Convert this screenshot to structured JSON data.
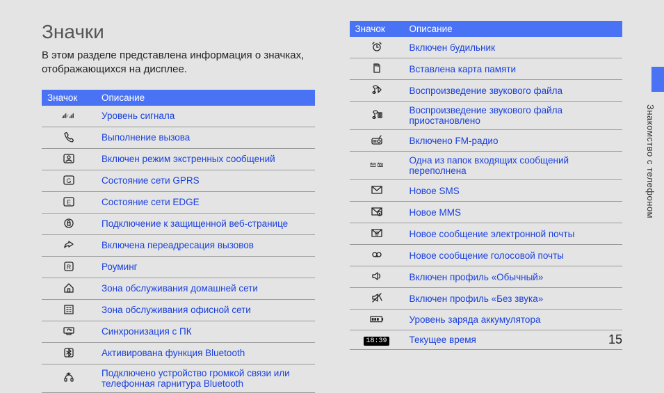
{
  "title": "Значки",
  "intro": "В этом разделе представлена информация о значках, отображающихся на дисплее.",
  "header_icon": "Значок",
  "header_desc": "Описание",
  "side_label": "Знакомство с телефоном",
  "page_number": "15",
  "time_label": "18:39",
  "left_rows": [
    {
      "icon": "signal",
      "desc": "Уровень сигнала"
    },
    {
      "icon": "call",
      "desc": "Выполнение вызова"
    },
    {
      "icon": "sos",
      "desc": "Включен режим экстренных сообщений"
    },
    {
      "icon": "gprs",
      "desc": "Состояние сети GPRS"
    },
    {
      "icon": "edge",
      "desc": "Состояние сети EDGE"
    },
    {
      "icon": "secure",
      "desc": "Подключение к защищенной веб-странице"
    },
    {
      "icon": "forward",
      "desc": "Включена переадресация вызовов"
    },
    {
      "icon": "roaming",
      "desc": "Роуминг"
    },
    {
      "icon": "home",
      "desc": "Зона обслуживания домашней сети"
    },
    {
      "icon": "office",
      "desc": "Зона обслуживания офисной сети"
    },
    {
      "icon": "sync",
      "desc": "Синхронизация с ПК"
    },
    {
      "icon": "bluetooth",
      "desc": "Активирована функция Bluetooth"
    },
    {
      "icon": "headset",
      "desc": "Подключено устройство громкой связи или телефонная гарнитура Bluetooth"
    }
  ],
  "right_rows": [
    {
      "icon": "alarm",
      "desc": "Включен будильник"
    },
    {
      "icon": "sdcard",
      "desc": "Вставлена карта памяти"
    },
    {
      "icon": "play",
      "desc": "Воспроизведение звукового файла"
    },
    {
      "icon": "pause",
      "desc": "Воспроизведение звукового файла приостановлено"
    },
    {
      "icon": "radio",
      "desc": "Включено FM-радио"
    },
    {
      "icon": "inboxfull",
      "desc": "Одна из папок входящих сообщений переполнена"
    },
    {
      "icon": "sms",
      "desc": "Новое SMS"
    },
    {
      "icon": "mms",
      "desc": "Новое MMS"
    },
    {
      "icon": "email",
      "desc": "Новое сообщение электронной почты"
    },
    {
      "icon": "voicemail",
      "desc": "Новое сообщение голосовой почты"
    },
    {
      "icon": "sound",
      "desc": "Включен профиль «Обычный»"
    },
    {
      "icon": "silent",
      "desc": "Включен профиль «Без звука»"
    },
    {
      "icon": "battery",
      "desc": "Уровень заряда аккумулятора"
    },
    {
      "icon": "time",
      "desc": "Текущее время"
    }
  ]
}
